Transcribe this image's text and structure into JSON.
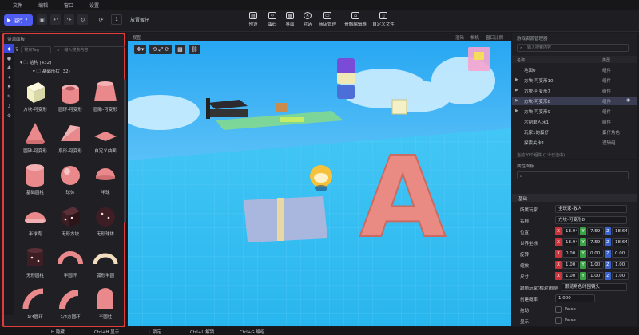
{
  "menu": [
    "文件",
    "编辑",
    "窗口",
    "设置"
  ],
  "toolbar": {
    "run_label": "运行",
    "step_value": "1",
    "step_label": "放置蛋仔",
    "tools": [
      {
        "icon": "preset-icon",
        "label": "预设"
      },
      {
        "icon": "code-icon",
        "label": "蛋码"
      },
      {
        "icon": "ui-icon",
        "label": "界面"
      },
      {
        "icon": "dialog-icon",
        "label": "对话"
      },
      {
        "icon": "store-icon",
        "label": "商店管理"
      },
      {
        "icon": "skeleton-editor-icon",
        "label": "骨骼编辑器"
      },
      {
        "icon": "custom-file-icon",
        "label": "自定义文件"
      }
    ]
  },
  "left_panel": {
    "title": "资源面板",
    "tag_placeholder": "搜索Tag",
    "search_placeholder": "输入搜索内容",
    "tree_root": "结构 (432)",
    "tree_child": "基础形状 (32)",
    "items": [
      {
        "label": "方块-可变形",
        "shape": "cube",
        "color": "#f2f0c6"
      },
      {
        "label": "圆环-可变形",
        "shape": "ring",
        "color": "#e9898c"
      },
      {
        "label": "圆锥-可变形",
        "shape": "frustum",
        "color": "#e9898c"
      },
      {
        "label": "圆锥-可变形",
        "shape": "cone",
        "color": "#e9898c"
      },
      {
        "label": "扇形-可变形",
        "shape": "wedge",
        "color": "#e9898c"
      },
      {
        "label": "自定义曲面",
        "shape": "surface",
        "color": "#e9898c"
      },
      {
        "label": "基础圆柱",
        "shape": "cylinder",
        "color": "#e9898c"
      },
      {
        "label": "球体",
        "shape": "sphere",
        "color": "#e9898c"
      },
      {
        "label": "半球",
        "shape": "halfsphere",
        "color": "#e9898c"
      },
      {
        "label": "半球壳",
        "shape": "dome",
        "color": "#e9898c"
      },
      {
        "label": "无形方块",
        "shape": "darkcube",
        "color": "#3c1e24"
      },
      {
        "label": "无形球体",
        "shape": "darksphere",
        "color": "#3c1e24"
      },
      {
        "label": "无形圆柱",
        "shape": "darkcylinder",
        "color": "#3c1e24"
      },
      {
        "label": "半圆环",
        "shape": "halfring",
        "color": "#e9898c"
      },
      {
        "label": "弧形半圆",
        "shape": "arc",
        "color": "#f2ddbf"
      },
      {
        "label": "1/4圆环",
        "shape": "quarter",
        "color": "#e9898c"
      },
      {
        "label": "1/4方圆环",
        "shape": "quarter2",
        "color": "#e9898c"
      },
      {
        "label": "半圆柱",
        "shape": "halfcyl",
        "color": "#e9898c"
      }
    ]
  },
  "viewport": {
    "title": "视图",
    "right_items": [
      "渲染",
      "相机",
      "窗口比例"
    ],
    "letter": "A"
  },
  "outliner": {
    "title": "游戏资源管理器",
    "search_placeholder": "输入搜索内容",
    "col_name": "名称",
    "col_type": "类型",
    "rows": [
      {
        "name": "地面0",
        "type": "组件",
        "selected": false,
        "arrow": false
      },
      {
        "name": "方块-可变形10",
        "type": "组件",
        "selected": false,
        "arrow": true
      },
      {
        "name": "方块-可变形7",
        "type": "组件",
        "selected": false,
        "arrow": true
      },
      {
        "name": "方块-可变形8",
        "type": "组件",
        "selected": true,
        "arrow": true
      },
      {
        "name": "方块-可变形9",
        "type": "组件",
        "selected": false,
        "arrow": true
      },
      {
        "name": "木制单人床1",
        "type": "组件",
        "selected": false,
        "arrow": false
      },
      {
        "name": "玩家1的蛋仔",
        "type": "蛋仔角色",
        "selected": false,
        "arrow": false
      },
      {
        "name": "探索关卡1",
        "type": "逻辑组",
        "selected": false,
        "arrow": false
      }
    ],
    "footnote": "当前20个组件  (1个已选中)"
  },
  "properties": {
    "title": "属性面板",
    "section": "基础",
    "owner_label": "所属玩家",
    "owner_value": "全玩家-敌人",
    "name_label": "名称",
    "name_value": "方块-可变形8",
    "position_label": "位置",
    "position": [
      "18.94",
      "7.59",
      "18.64"
    ],
    "world_label": "世界坐标",
    "world": [
      "18.94",
      "7.59",
      "18.64"
    ],
    "rotation_label": "旋转",
    "rotation": [
      "0.00",
      "0.00",
      "0.00"
    ],
    "scale_label": "缩放",
    "scale": [
      "1.00",
      "1.00",
      "1.00"
    ],
    "size_label": "尺寸",
    "size": [
      "1.00",
      "1.00",
      "1.00"
    ],
    "follow_label": "跟随玩家(相对)规则",
    "follow_value": "跟随角色时围镜头",
    "density_label": "创建概率",
    "density_value": "1.000",
    "physics_label": "拖动",
    "physics_value": "False",
    "last_label": "显示",
    "last_value": "False"
  },
  "status": {
    "h_key": "H 隐藏",
    "ctrl_h": "Ctrl+H 显示",
    "l_key": "L 锁定",
    "ctrl_l": "Ctrl+L 解锁",
    "ctrl_g": "Ctrl+G 编组"
  }
}
